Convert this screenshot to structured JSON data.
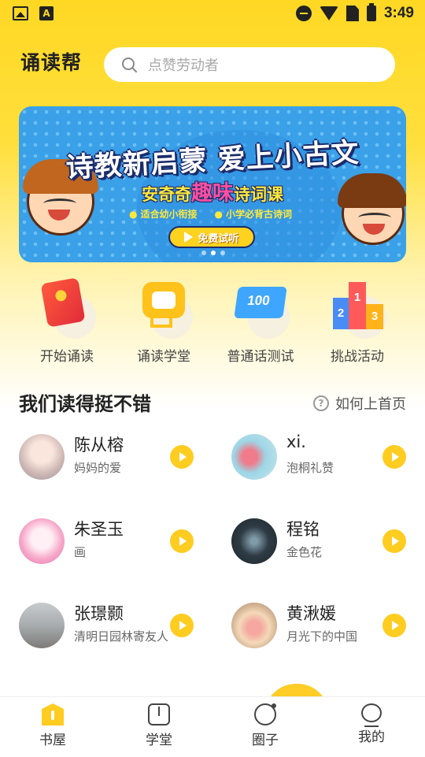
{
  "status_bar": {
    "time": "3:49",
    "left_badge": "A"
  },
  "header": {
    "app_title": "诵读帮",
    "search_placeholder": "点赞劳动者"
  },
  "banner": {
    "headline": "诗教新启蒙 爱上小古文",
    "sub_prefix": "安奇奇",
    "sub_highlight": "趣味",
    "sub_suffix": "诗词课",
    "point1": "适合幼小衔接",
    "point2": "小学必背古诗词",
    "button_label": "免费试听",
    "slides": 3,
    "active_slide": 2
  },
  "quick_actions": [
    {
      "label": "开始诵读",
      "icon": "book-icon"
    },
    {
      "label": "诵读学堂",
      "icon": "robot-icon"
    },
    {
      "label": "普通话测试",
      "icon": "score-scroll-icon",
      "icon_text": "100"
    },
    {
      "label": "挑战活动",
      "icon": "podium-icon",
      "icon_text": [
        "2",
        "1",
        "3"
      ]
    }
  ],
  "section": {
    "title": "我们读得挺不错",
    "help_label": "如何上首页"
  },
  "readers": [
    {
      "name": "陈从榕",
      "work": "妈妈的爱"
    },
    {
      "name": "xi.",
      "work": "泡桐礼赞"
    },
    {
      "name": "朱圣玉",
      "work": "画"
    },
    {
      "name": "程铭",
      "work": "金色花"
    },
    {
      "name": "张璟颢",
      "work": "清明日园林寄友人"
    },
    {
      "name": "黄湫媛",
      "work": "月光下的中国"
    }
  ],
  "tabbar": [
    {
      "label": "书屋",
      "icon": "home-icon",
      "active": true
    },
    {
      "label": "学堂",
      "icon": "school-icon",
      "active": false
    },
    {
      "label": "圈子",
      "icon": "circle-icon",
      "active": false
    },
    {
      "label": "我的",
      "icon": "profile-icon",
      "active": false
    }
  ],
  "colors": {
    "accent": "#ffcc20",
    "header_bg": "#ffd824",
    "banner_blue": "#3aa0e8"
  }
}
